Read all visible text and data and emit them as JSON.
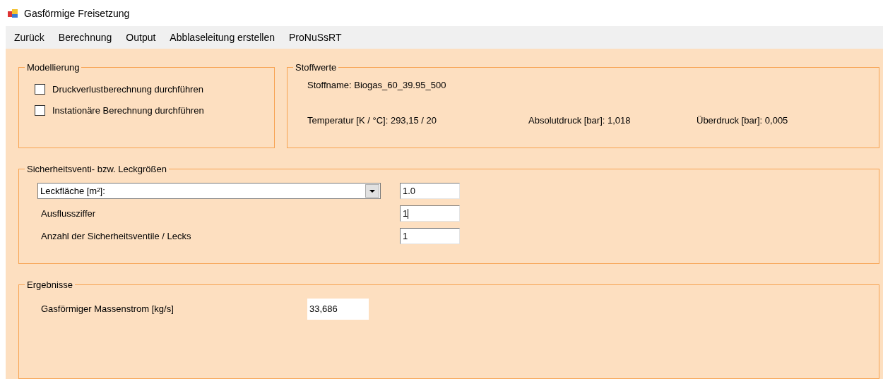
{
  "window": {
    "title": "Gasförmige Freisetzung"
  },
  "menu": [
    "Zurück",
    "Berechnung",
    "Output",
    "Abblaseleitung erstellen",
    "ProNuSsRT"
  ],
  "modellierung": {
    "title": "Modellierung",
    "options": [
      {
        "label": "Druckverlustberechnung durchführen",
        "checked": false
      },
      {
        "label": "Instationäre Berechnung durchführen",
        "checked": false
      }
    ]
  },
  "stoffwerte": {
    "title": "Stoffwerte",
    "name": "Stoffname: Biogas_60_39.95_500",
    "temperature": "Temperatur [K / °C]: 293,15 / 20",
    "absolute_pressure": "Absolutdruck [bar]: 1,018",
    "overpressure": "Überdruck [bar]: 0,005"
  },
  "sicherheit": {
    "title": "Sicherheitsventi- bzw. Leckgrößen",
    "dropdown": "Leckfläche [m²]:",
    "dropdown_value": "1.0",
    "rows": [
      {
        "label": "Ausflussziffer",
        "value": "1",
        "focused": true
      },
      {
        "label": "Anzahl der Sicherheitsventile / Lecks",
        "value": "1",
        "focused": false
      }
    ]
  },
  "ergebnisse": {
    "title": "Ergebnisse",
    "label": "Gasförmiger Massenstrom [kg/s]",
    "value": "33,686"
  }
}
